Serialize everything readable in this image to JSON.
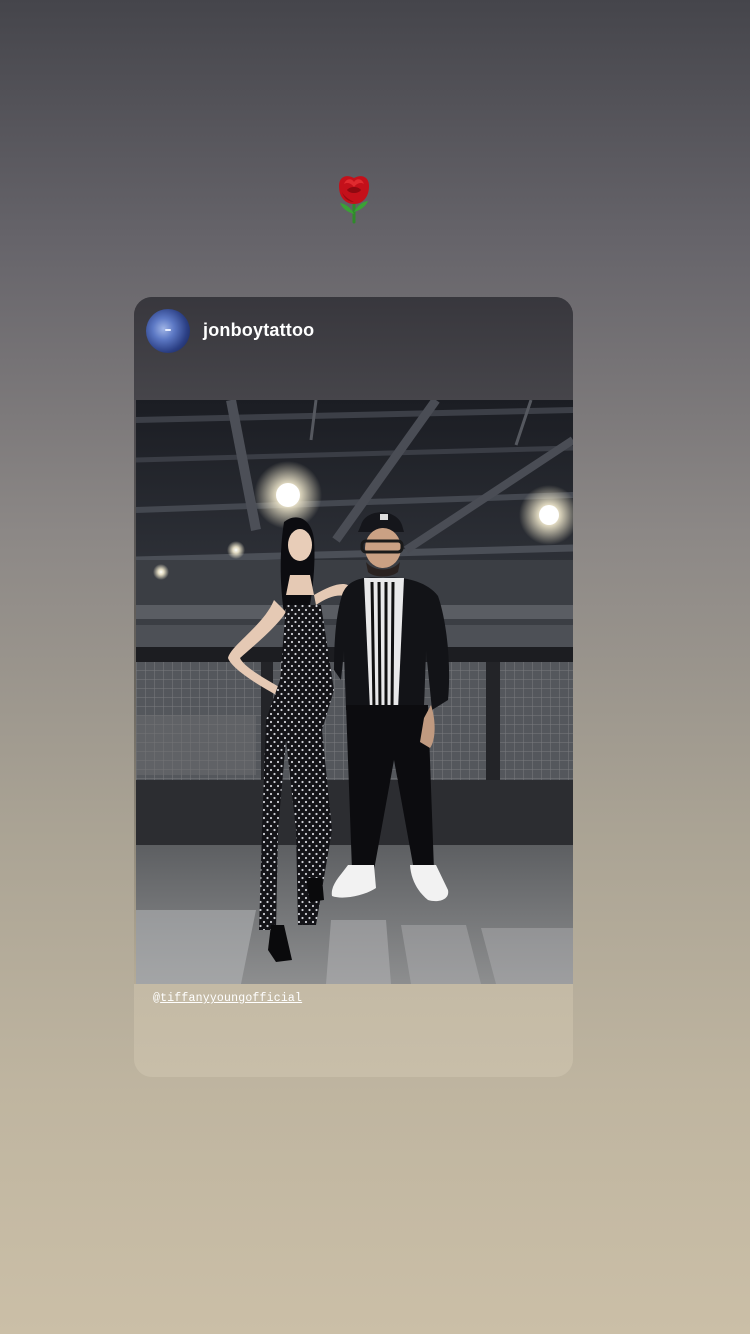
{
  "story": {
    "sticker_icon": "rose-emoji-icon"
  },
  "shared_post": {
    "username": "jonboytattoo",
    "avatar_icon": "avatar-icon",
    "caption_prefix": "@",
    "caption_handle": "tiffanyyoungofficial"
  },
  "colors": {
    "background_top": "#45454b",
    "background_bottom": "#cbbfa7",
    "card_header": "#3e3d43",
    "caption_bg": "#c5bba6",
    "text": "#ffffff"
  }
}
